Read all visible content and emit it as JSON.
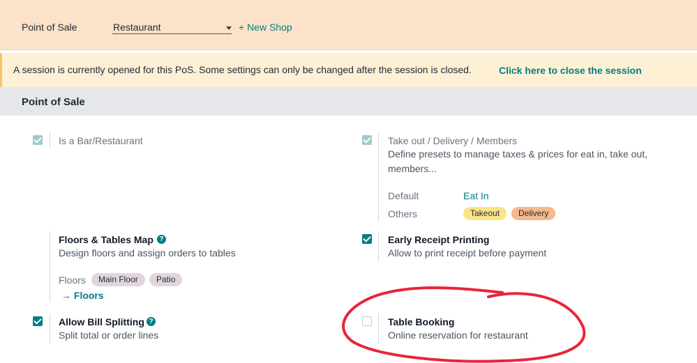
{
  "topbar": {
    "title": "Point of Sale",
    "shop_value": "Restaurant",
    "new_shop": "+ New Shop"
  },
  "alert": {
    "message": "A session is currently opened for this PoS. Some settings can only be changed after the session is closed.",
    "action": "Click here to close the session"
  },
  "section": {
    "title": "Point of Sale"
  },
  "settings": {
    "bar_restaurant": {
      "label": "Is a Bar/Restaurant",
      "checked": true,
      "disabled": true
    },
    "takeout": {
      "label": "Take out / Delivery / Members",
      "description": "Define presets to manage taxes & prices for eat in, take out, members...",
      "checked": true,
      "disabled": true,
      "default_key": "Default",
      "default_value": "Eat In",
      "others_key": "Others",
      "others_tags": [
        "Takeout",
        "Delivery"
      ]
    },
    "floors": {
      "label": "Floors & Tables Map",
      "description": "Design floors and assign orders to tables",
      "floors_key": "Floors",
      "floor_tags": [
        "Main Floor",
        "Patio"
      ],
      "link": "Floors"
    },
    "early_receipt": {
      "label": "Early Receipt Printing",
      "description": "Allow to print receipt before payment",
      "checked": true
    },
    "bill_splitting": {
      "label": "Allow Bill Splitting",
      "description": "Split total or order lines",
      "checked": true
    },
    "table_booking": {
      "label": "Table Booking",
      "description": "Online reservation for restaurant",
      "checked": false
    }
  },
  "colors": {
    "accent": "#017e84",
    "topbar_bg": "#fbe2c8",
    "alert_bg": "#fdf0d4",
    "annotation": "#e8253a"
  },
  "icons": [
    "checkbox-checked-icon",
    "checkbox-empty-icon",
    "help-icon",
    "arrow-right-icon",
    "dropdown-caret-icon"
  ]
}
